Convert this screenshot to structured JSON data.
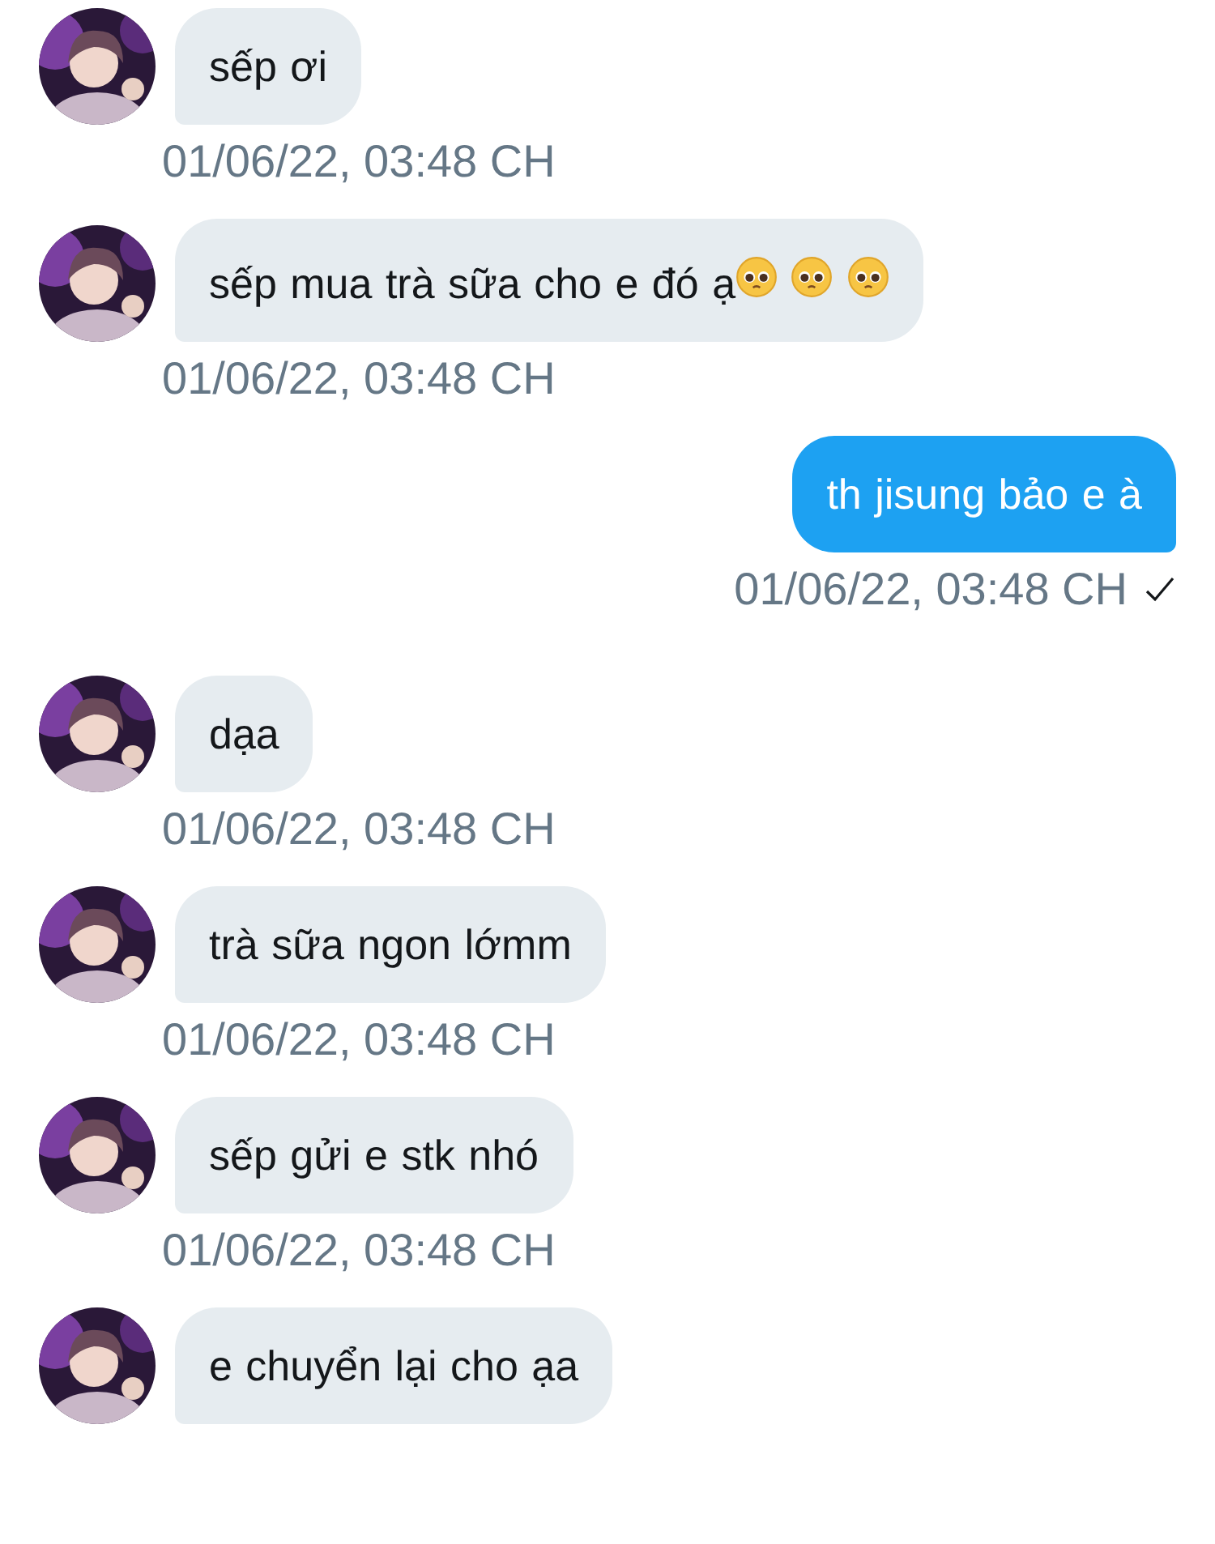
{
  "messages": [
    {
      "kind": "received",
      "text": "sếp ơi",
      "time": "01/06/22, 03:48 CH"
    },
    {
      "kind": "received",
      "text": "sếp mua trà sữa cho e đó ạ",
      "emojis": [
        {
          "kind": "pleading-face"
        },
        {
          "kind": "pleading-face"
        },
        {
          "kind": "pleading-face"
        }
      ],
      "time": "01/06/22, 03:48 CH"
    },
    {
      "kind": "sent",
      "text": "th jisung bảo e à",
      "time": "01/06/22, 03:48 CH",
      "delivered": true
    },
    {
      "kind": "received",
      "text": "dạa",
      "time": "01/06/22, 03:48 CH"
    },
    {
      "kind": "received",
      "text": "trà sữa ngon lớmm",
      "time": "01/06/22, 03:48 CH"
    },
    {
      "kind": "received",
      "text": "sếp gửi e stk nhó",
      "time": "01/06/22, 03:48 CH"
    },
    {
      "kind": "received",
      "text": "e chuyển lại cho ạa"
    }
  ]
}
